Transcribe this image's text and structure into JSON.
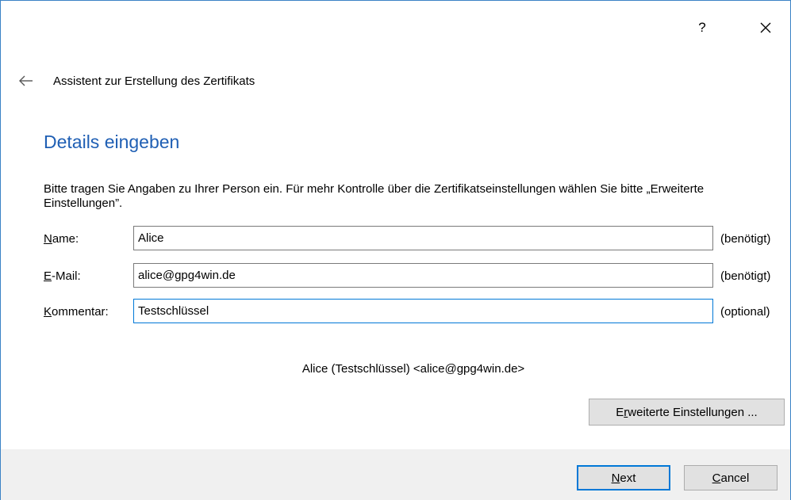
{
  "titlebar": {
    "help_label": "?",
    "close_icon": "close-icon"
  },
  "header": {
    "back_icon": "back-arrow-icon",
    "wizard_title": "Assistent zur Erstellung des Zertifikats"
  },
  "page": {
    "heading": "Details eingeben",
    "intro": "Bitte tragen Sie Angaben zu Ihrer Person ein. Für mehr Kontrolle über die Zertifikatseinstellungen wählen Sie bitte „Erweiterte Einstellungen”."
  },
  "form": {
    "name": {
      "label_access": "N",
      "label_rest": "ame:",
      "value": "Alice",
      "hint": "(benötigt)"
    },
    "email": {
      "label_access": "E",
      "label_rest": "-Mail:",
      "value": "alice@gpg4win.de",
      "hint": "(benötigt)"
    },
    "comment": {
      "label_access": "K",
      "label_rest": "ommentar:",
      "value": "Testschlüssel",
      "hint": "(optional)"
    }
  },
  "preview": "Alice (Testschlüssel) <alice@gpg4win.de>",
  "buttons": {
    "advanced_pre": "E",
    "advanced_access": "r",
    "advanced_post": "weiterte Einstellungen ...",
    "next_access": "N",
    "next_rest": "ext",
    "cancel_access": "C",
    "cancel_rest": "ancel"
  },
  "colors": {
    "heading": "#1f5fb4",
    "focus_border": "#0078d7",
    "window_border": "#3b83c6",
    "footer_bg": "#f0f0f0"
  }
}
